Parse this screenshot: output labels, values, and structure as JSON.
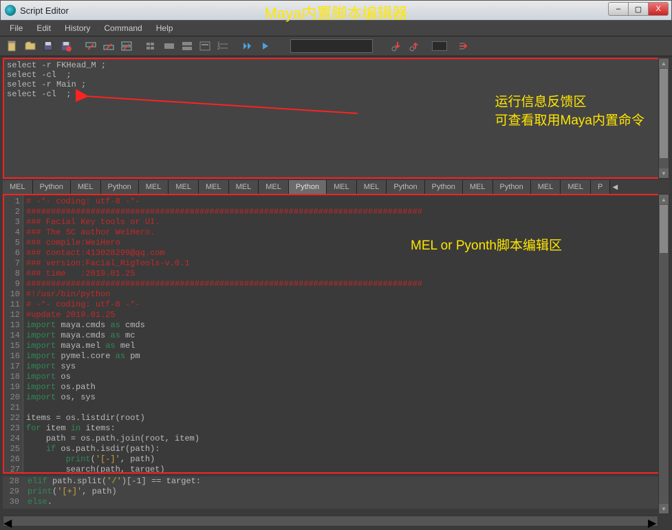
{
  "window": {
    "title": "Script Editor",
    "controls": {
      "min": "–",
      "max": "▢",
      "close": "X"
    }
  },
  "header_annotation": "Maya内置脚本编辑器",
  "menu": [
    "File",
    "Edit",
    "History",
    "Command",
    "Help"
  ],
  "output_lines": [
    "select -r FKHead_M ;",
    "select -cl  ;",
    "select -r Main ;",
    "select -cl  ;"
  ],
  "output_annotation": {
    "l1": "运行信息反馈区",
    "l2": "可查看取用Maya内置命令"
  },
  "tabs": [
    "MEL",
    "Python",
    "MEL",
    "Python",
    "MEL",
    "MEL",
    "MEL",
    "MEL",
    "MEL",
    "Python",
    "MEL",
    "MEL",
    "Python",
    "Python",
    "MEL",
    "Python",
    "MEL",
    "MEL",
    "P"
  ],
  "active_tab_index": 9,
  "editor_annotation": "MEL or Pyonth脚本编辑区",
  "code_lines": [
    {
      "n": 1,
      "cls": "cm",
      "t": "# -*- coding: utf-8 -*-"
    },
    {
      "n": 2,
      "cls": "cm",
      "t": "################################################################################"
    },
    {
      "n": 3,
      "cls": "cm",
      "t": "### Facial Key tools or UI."
    },
    {
      "n": 4,
      "cls": "cm",
      "t": "### The SC author WeiHero."
    },
    {
      "n": 5,
      "cls": "cm",
      "t": "### compile:WeiHero"
    },
    {
      "n": 6,
      "cls": "cm",
      "t": "### contact:413028299@qq.com"
    },
    {
      "n": 7,
      "cls": "cm",
      "t": "### version:Facial_RigTools-v.0.1"
    },
    {
      "n": 8,
      "cls": "cm",
      "t": "### time   :2019.01.25"
    },
    {
      "n": 9,
      "cls": "cm",
      "t": "################################################################################"
    },
    {
      "n": 10,
      "cls": "cm",
      "t": "#!/usr/bin/python"
    },
    {
      "n": 11,
      "cls": "cm",
      "t": "# -*- coding: utf-8 -*-"
    },
    {
      "n": 12,
      "cls": "cm",
      "t": "#update 2019.01.25"
    },
    {
      "n": 13,
      "cls": "mix",
      "t": "<kw>import</kw> <id>maya.cmds</id> <kw>as</kw> <id>cmds</id>"
    },
    {
      "n": 14,
      "cls": "mix",
      "t": "<kw>import</kw> <id>maya.cmds</id> <kw>as</kw> <id>mc</id>"
    },
    {
      "n": 15,
      "cls": "mix",
      "t": "<kw>import</kw> <id>maya.mel</id> <kw>as</kw> <id>mel</id>"
    },
    {
      "n": 16,
      "cls": "mix",
      "t": "<kw>import</kw> <id>pymel.core</id> <kw>as</kw> <id>pm</id>"
    },
    {
      "n": 17,
      "cls": "mix",
      "t": "<kw>import</kw> <id>sys</id>"
    },
    {
      "n": 18,
      "cls": "mix",
      "t": "<kw>import</kw> <id>os</id>"
    },
    {
      "n": 19,
      "cls": "mix",
      "t": "<kw>import</kw> <id>os.path</id>"
    },
    {
      "n": 20,
      "cls": "mix",
      "t": "<kw>import</kw> <id>os, sys</id>"
    },
    {
      "n": 21,
      "cls": "id",
      "t": ""
    },
    {
      "n": 22,
      "cls": "mix",
      "t": "<id>items</id> <op>=</op> <id>os.listdir(root)</id>"
    },
    {
      "n": 23,
      "cls": "mix",
      "t": "<kw>for</kw> <id>item</id> <kw>in</kw> <id>items:</id>"
    },
    {
      "n": 24,
      "cls": "mix",
      "t": "    <id>path</id> <op>=</op> <id>os.path.join(root, item)</id>"
    },
    {
      "n": 25,
      "cls": "mix",
      "t": "    <kw>if</kw> <id>os.path.isdir(path):</id>"
    },
    {
      "n": 26,
      "cls": "mix",
      "t": "        <kw>print</kw><id>(</id><str>'[-]'</str><id>, path)</id>"
    },
    {
      "n": 27,
      "cls": "mix",
      "t": "        <id>search(path, target)</id>"
    }
  ],
  "extra_lines": [
    {
      "n": 28,
      "t": "    <kw>elif</kw> <id>path.split(</id><str>'/'</str><id>)[</id><op>-</op><id>1]</id> <op>==</op> <id>target:</id>"
    },
    {
      "n": 29,
      "t": "        <kw>print</kw><id>(</id><str>'[+]'</str><id>, path)</id>"
    },
    {
      "n": 30,
      "t": "    <kw>else</kw><id>.</id>"
    }
  ]
}
